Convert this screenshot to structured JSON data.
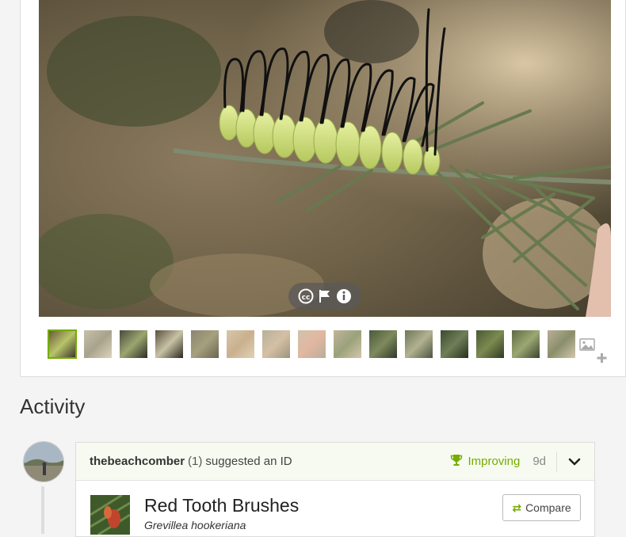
{
  "photo_controls": {
    "icons": [
      "cc-license-icon",
      "flag-icon",
      "info-icon"
    ]
  },
  "thumbnails": {
    "count": 15,
    "active_index": 0
  },
  "activity": {
    "title": "Activity",
    "identification": {
      "user": "thebeachcomber",
      "user_count": "(1)",
      "action": "suggested an ID",
      "status": "Improving",
      "time_ago": "9d",
      "taxon_common": "Red Tooth Brushes",
      "taxon_scientific": "Grevillea hookeriana",
      "compare_label": "Compare"
    }
  },
  "colors": {
    "accent": "#74ac00",
    "header_bg": "#f7faf1"
  }
}
